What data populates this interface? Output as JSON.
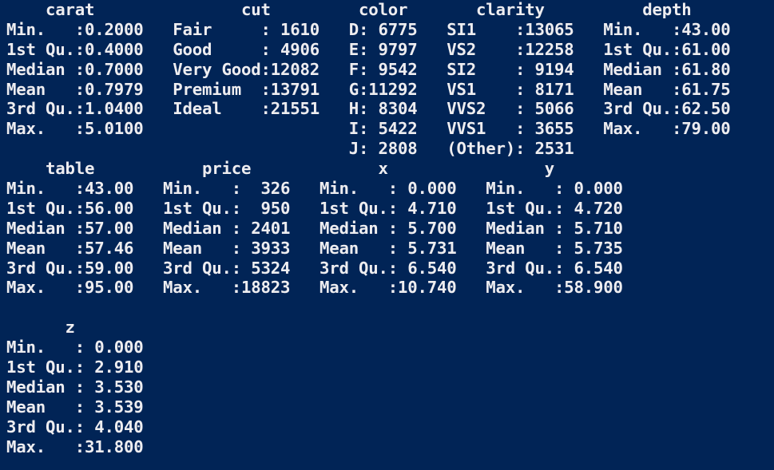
{
  "window": {
    "background": "#012456",
    "foreground": "#eeedf0"
  },
  "console": {
    "lines": [
      "    carat               cut         color       clarity          depth      ",
      "Min.   :0.2000   Fair     : 1610   D: 6775   SI1    :13065   Min.   :43.00  ",
      "1st Qu.:0.4000   Good     : 4906   E: 9797   VS2    :12258   1st Qu.:61.00  ",
      "Median :0.7000   Very Good:12082   F: 9542   SI2    : 9194   Median :61.80  ",
      "Mean   :0.7979   Premium  :13791   G:11292   VS1    : 8171   Mean   :61.75  ",
      "3rd Qu.:1.0400   Ideal    :21551   H: 8304   VVS2   : 5066   3rd Qu.:62.50  ",
      "Max.   :5.0100                     I: 5422   VVS1   : 3655   Max.   :79.00  ",
      "                                   J: 2808   (Other): 2531                  ",
      "    table           price             x                y        ",
      "Min.   :43.00   Min.   :  326   Min.   : 0.000   Min.   : 0.000  ",
      "1st Qu.:56.00   1st Qu.:  950   1st Qu.: 4.710   1st Qu.: 4.720  ",
      "Median :57.00   Median : 2401   Median : 5.700   Median : 5.710  ",
      "Mean   :57.46   Mean   : 3933   Mean   : 5.731   Mean   : 5.735  ",
      "3rd Qu.:59.00   3rd Qu.: 5324   3rd Qu.: 6.540   3rd Qu.: 6.540  ",
      "Max.   :95.00   Max.   :18823   Max.   :10.740   Max.   :58.900  ",
      "",
      "      z         ",
      "Min.   : 0.000  ",
      "1st Qu.: 2.910  ",
      "Median : 3.530  ",
      "Mean   : 3.539  ",
      "3rd Qu.: 4.040  ",
      "Max.   :31.800  "
    ]
  }
}
